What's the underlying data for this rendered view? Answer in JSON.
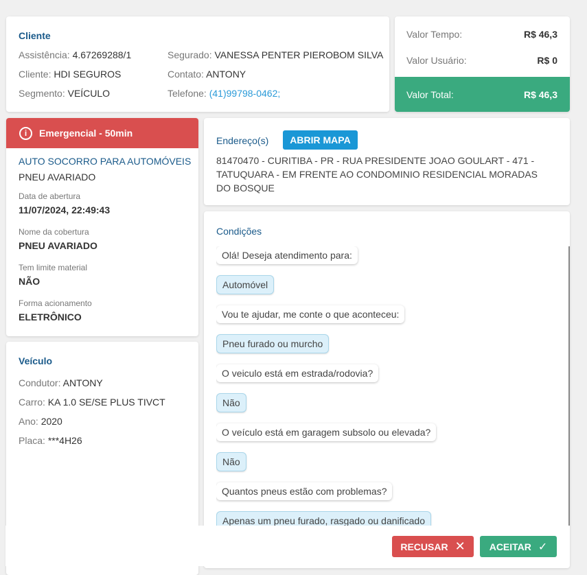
{
  "cliente": {
    "title": "Cliente",
    "assistencia_label": "Assistência:",
    "assistencia": "4.67269288/1",
    "cliente_label": "Cliente:",
    "cliente": "HDI SEGUROS",
    "segmento_label": "Segmento:",
    "segmento": "VEÍCULO",
    "segurado_label": "Segurado:",
    "segurado": "VANESSA PENTER PIEROBOM SILVA",
    "contato_label": "Contato:",
    "contato": "ANTONY",
    "telefone_label": "Telefone:",
    "telefone": "(41)99798-0462;"
  },
  "valores": {
    "tempo_label": "Valor Tempo:",
    "tempo": "R$ 46,3",
    "usuario_label": "Valor Usuário:",
    "usuario": "R$ 0",
    "total_label": "Valor Total:",
    "total": "R$ 46,3",
    "total_color": "#3aaa7f"
  },
  "servico": {
    "badge": "Emergencial - 50min",
    "badge_color": "#d94f4f",
    "tipo": "AUTO SOCORRO PARA AUTOMÓVEIS",
    "subtipo": "PNEU AVARIADO",
    "data_label": "Data de abertura",
    "data": "11/07/2024, 22:49:43",
    "cobertura_label": "Nome da cobertura",
    "cobertura": "PNEU AVARIADO",
    "limite_label": "Tem limite material",
    "limite": "NÃO",
    "forma_label": "Forma acionamento",
    "forma": "ELETRÔNICO"
  },
  "veiculo": {
    "title": "Veículo",
    "condutor_label": "Condutor:",
    "condutor": "ANTONY",
    "carro_label": "Carro:",
    "carro": "KA 1.0 SE/SE PLUS TIVCT",
    "ano_label": "Ano:",
    "ano": "2020",
    "placa_label": "Placa:",
    "placa": "***4H26"
  },
  "endereco": {
    "title": "Endereço(s)",
    "map_button": "ABRIR MAPA",
    "text": "81470470 - CURITIBA - PR - RUA PRESIDENTE JOAO GOULART - 471 - TATUQUARA - EM FRENTE AO CONDOMINIO RESIDENCIAL MORADAS DO BOSQUE"
  },
  "condicoes": {
    "title": "Condições",
    "messages": [
      {
        "text": "Olá! Deseja atendimento para:",
        "answer": false
      },
      {
        "text": "Automóvel",
        "answer": true
      },
      {
        "text": "Vou te ajudar, me conte o que aconteceu:",
        "answer": false
      },
      {
        "text": "Pneu furado ou murcho",
        "answer": true
      },
      {
        "text": "O veiculo está em estrada/rodovia?",
        "answer": false
      },
      {
        "text": "Não",
        "answer": true
      },
      {
        "text": "O veículo está em garagem subsolo ou elevada?",
        "answer": false
      },
      {
        "text": "Não",
        "answer": true
      },
      {
        "text": "Quantos pneus estão com problemas?",
        "answer": false
      },
      {
        "text": "Apenas um pneu furado, rasgado ou danificado",
        "answer": true
      }
    ]
  },
  "actions": {
    "recusar": "RECUSAR",
    "aceitar": "ACEITAR"
  }
}
